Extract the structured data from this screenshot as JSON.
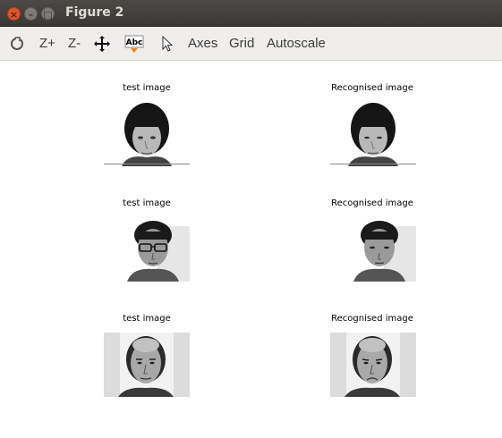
{
  "window": {
    "title": "Figure 2",
    "controls": {
      "close": "×",
      "minimize": "–",
      "maximize": "□"
    }
  },
  "toolbar": {
    "icons": [
      "rotate-icon",
      "pointer-icon"
    ],
    "zoom_in": "Z+",
    "zoom_out": "Z-",
    "pan_icon": "pan-icon",
    "text_tool": "Abc",
    "axes": "Axes",
    "grid": "Grid",
    "autoscale": "Autoscale"
  },
  "figure": {
    "rows": [
      {
        "left_title": "test image",
        "right_title": "Recognised image"
      },
      {
        "left_title": "test image",
        "right_title": "Recognised image"
      },
      {
        "left_title": "test image",
        "right_title": "Recognised image"
      }
    ],
    "images": [
      "grayscale face, woman with dark bob haircut",
      "grayscale face, man with glasses",
      "grayscale face, bald man"
    ]
  }
}
